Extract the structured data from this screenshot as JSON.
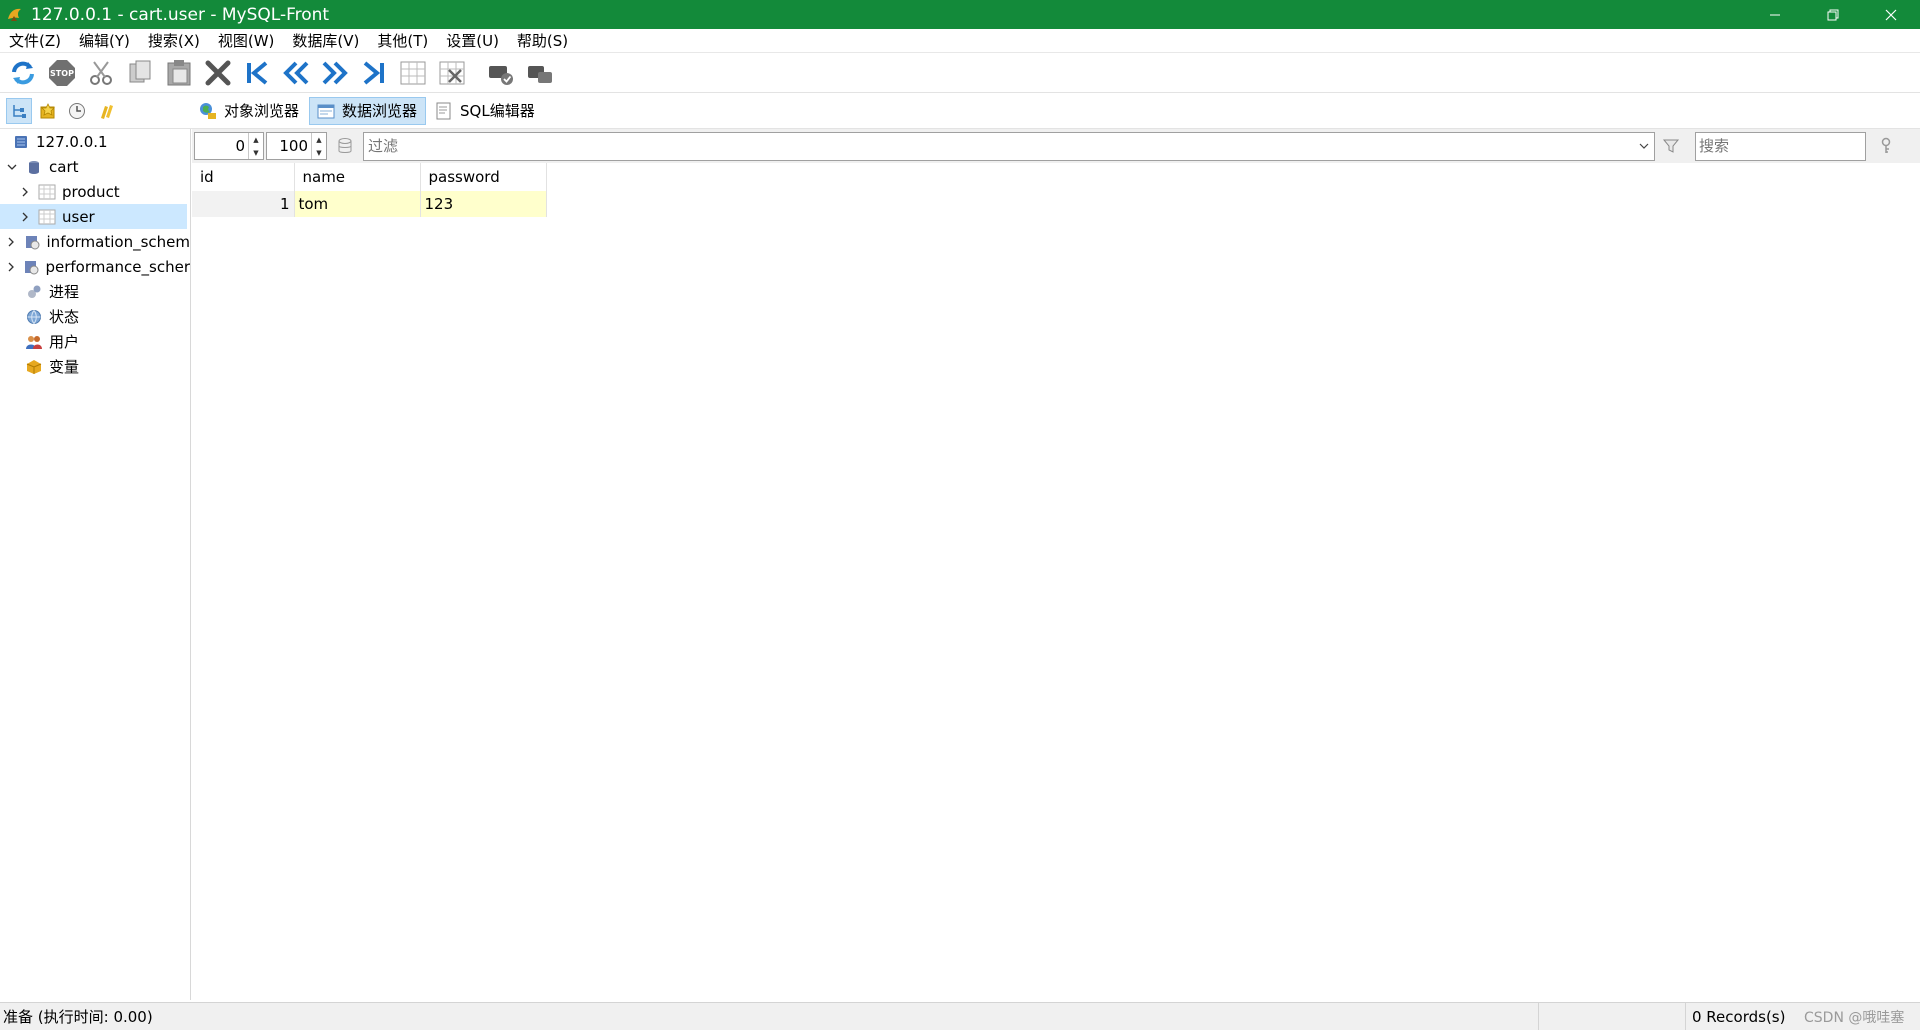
{
  "window": {
    "title": "127.0.0.1 - cart.user - MySQL-Front",
    "titlebar_color": "#138a3a"
  },
  "menu": [
    "文件(Z)",
    "编辑(Y)",
    "搜索(X)",
    "视图(W)",
    "数据库(V)",
    "其他(T)",
    "设置(U)",
    "帮助(S)"
  ],
  "toolbar": {
    "icons": [
      "refresh-icon",
      "stop-icon",
      "cut-icon",
      "copy-icon",
      "paste-icon",
      "delete-icon",
      "first-record-icon",
      "previous-page-icon",
      "next-page-icon",
      "last-record-icon",
      "insert-record-icon",
      "delete-record-icon",
      "post-record-icon",
      "cancel-record-icon"
    ],
    "stop_label": "STOP"
  },
  "viewbar": {
    "tabs": [
      "对象浏览器",
      "数据浏览器",
      "SQL编辑器"
    ],
    "active_tab": "数据浏览器"
  },
  "tree": {
    "server": "127.0.0.1",
    "database": "cart",
    "tables": [
      "product",
      "user"
    ],
    "selected_table": "user",
    "other_databases": [
      "information_schem",
      "performance_scher"
    ],
    "server_items": [
      "进程",
      "状态",
      "用户",
      "变量"
    ]
  },
  "filter": {
    "offset": "0",
    "limit": "100",
    "filter_placeholder": "过滤",
    "search_placeholder": "搜索"
  },
  "grid": {
    "columns": [
      "id",
      "name",
      "password"
    ],
    "rows": [
      {
        "id": "1",
        "name": "tom",
        "password": "123"
      }
    ]
  },
  "status": {
    "message": "准备  (执行时间: 0.00)",
    "records": "0 Records(s)",
    "watermark": "CSDN @哦哇塞"
  }
}
